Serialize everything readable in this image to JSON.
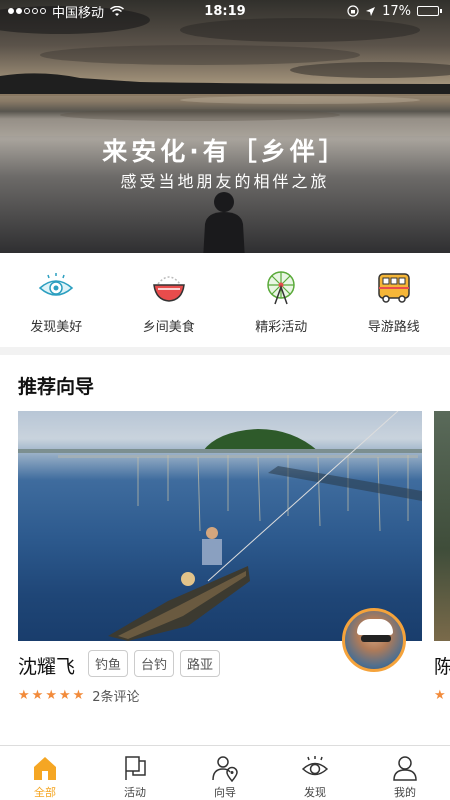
{
  "status_bar": {
    "carrier": "中国移动",
    "time": "18:19",
    "battery": "17%",
    "battery_level": 0.17
  },
  "hero": {
    "title": "来安化·有［乡伴］",
    "subtitle": "感受当地朋友的相伴之旅"
  },
  "categories": [
    {
      "label": "发现美好",
      "icon": "eye-icon"
    },
    {
      "label": "乡间美食",
      "icon": "rice-bowl-icon"
    },
    {
      "label": "精彩活动",
      "icon": "ferris-wheel-icon"
    },
    {
      "label": "导游路线",
      "icon": "bus-icon"
    }
  ],
  "recommend": {
    "title": "推荐向导",
    "guides": [
      {
        "name": "沈耀飞",
        "tags": [
          "钓鱼",
          "台钓",
          "路亚"
        ],
        "rating": 5,
        "reviews": "2条评论"
      },
      {
        "name": "陈",
        "rating": 1
      }
    ]
  },
  "tabbar": {
    "accent": "#f5a623",
    "items": [
      {
        "label": "全部",
        "icon": "home-icon",
        "active": true
      },
      {
        "label": "活动",
        "icon": "flag-icon",
        "active": false
      },
      {
        "label": "向导",
        "icon": "guide-person-icon",
        "active": false
      },
      {
        "label": "发现",
        "icon": "eye-icon",
        "active": false
      },
      {
        "label": "我的",
        "icon": "user-icon",
        "active": false
      }
    ]
  }
}
